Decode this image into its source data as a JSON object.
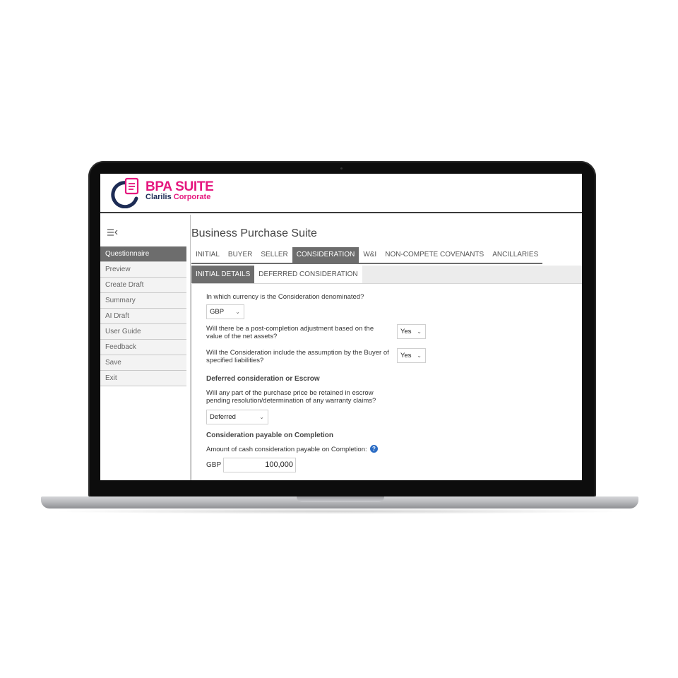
{
  "brand": {
    "title": "BPA SUITE",
    "subtitle_part1": "Clarilis",
    "subtitle_part2": "Corporate",
    "primary_color": "#e5177e",
    "secondary_color": "#1d2c55"
  },
  "sidebar": {
    "toggle_icon": "collapse-menu-icon",
    "items": [
      {
        "label": "Questionnaire",
        "active": true
      },
      {
        "label": "Preview"
      },
      {
        "label": "Create Draft"
      },
      {
        "label": "Summary"
      },
      {
        "label": "AI Draft"
      },
      {
        "label": "User Guide"
      },
      {
        "label": "Feedback"
      },
      {
        "label": "Save"
      },
      {
        "label": "Exit"
      }
    ]
  },
  "main": {
    "title": "Business Purchase Suite",
    "tabs": [
      {
        "label": "INITIAL"
      },
      {
        "label": "BUYER"
      },
      {
        "label": "SELLER"
      },
      {
        "label": "CONSIDERATION",
        "active": true
      },
      {
        "label": "W&I"
      },
      {
        "label": "NON-COMPETE COVENANTS"
      },
      {
        "label": "ANCILLARIES"
      }
    ],
    "subtabs": [
      {
        "label": "INITIAL DETAILS",
        "active": true
      },
      {
        "label": "DEFERRED CONSIDERATION"
      }
    ]
  },
  "form": {
    "q1": "In which currency is the Consideration denominated?",
    "q1_value": "GBP",
    "q2_line1": "Will there be a post-completion adjustment based on the",
    "q2_line2": "value of the net assets?",
    "q2_value": "Yes",
    "q3_line1": "Will the Consideration include the assumption by the Buyer of",
    "q3_line2": "specified liabilities?",
    "q3_value": "Yes",
    "section1": "Deferred consideration or Escrow",
    "q4_line1": "Will any part of the purchase price be retained in escrow",
    "q4_line2": "pending resolution/determination of any warranty claims?",
    "q4_value": "Deferred",
    "section2": "Consideration payable on Completion",
    "q5": "Amount of cash consideration payable on Completion:",
    "q5_help": "?",
    "q5_currency": "GBP",
    "q5_amount": "100,000"
  }
}
